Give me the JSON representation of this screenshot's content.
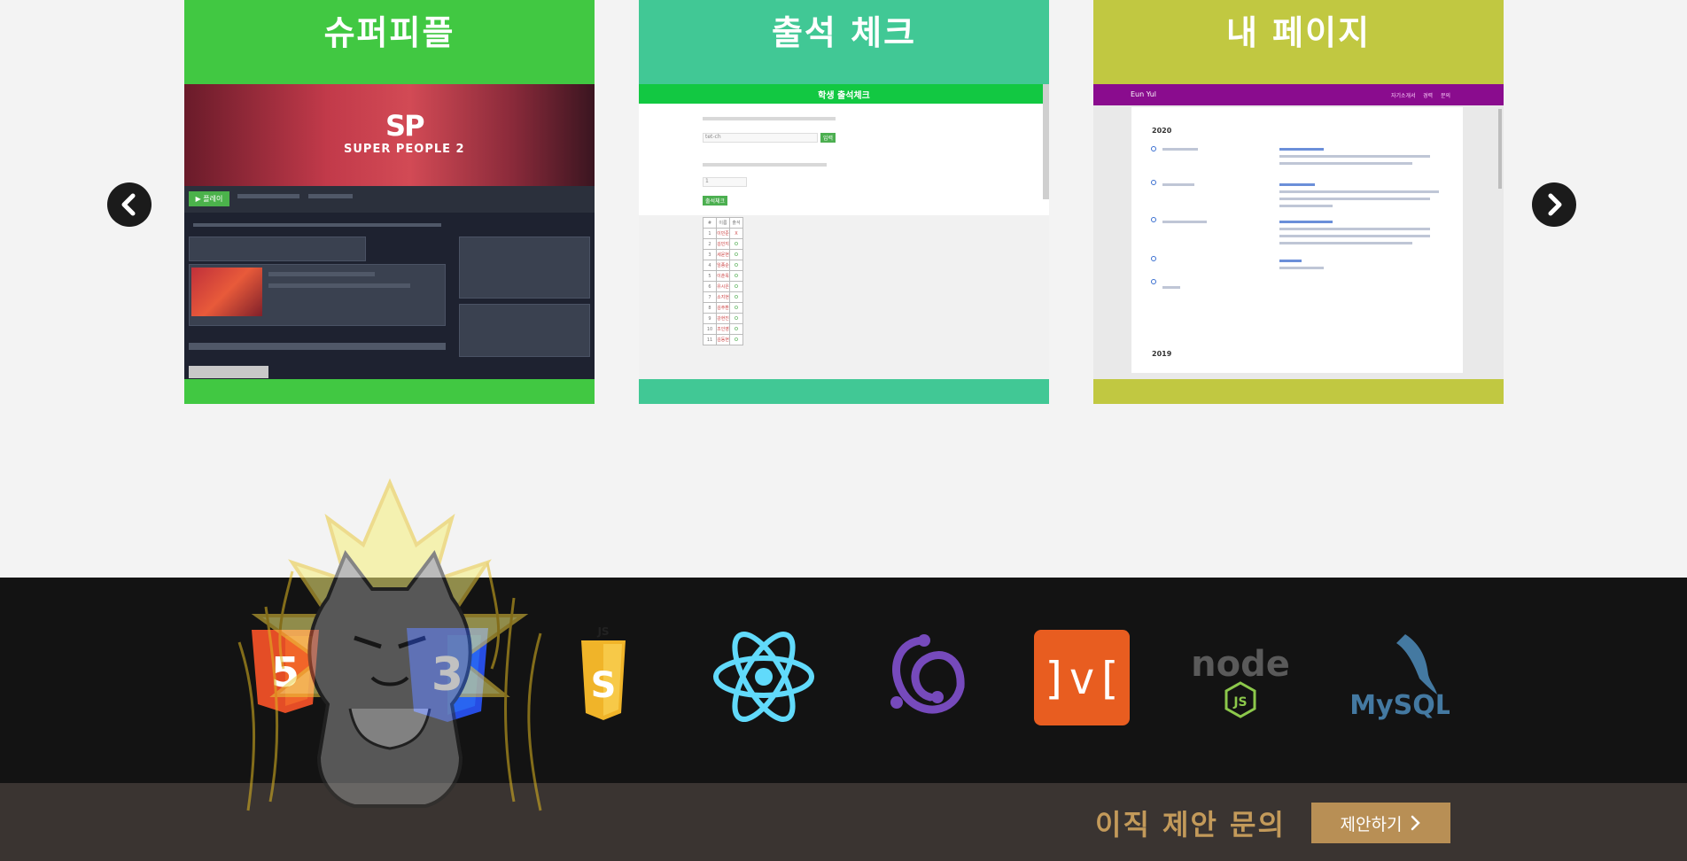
{
  "projects": [
    {
      "title": "슈퍼피플",
      "color": "#41c842",
      "shot": {
        "logo_mark": "SP",
        "logo_text": "SUPER PEOPLE 2",
        "play_label": "▶ 플레이"
      }
    },
    {
      "title": "출석 체크",
      "color": "#41c895",
      "shot": {
        "header": "학생 출석체크",
        "first_input": "tet-ch",
        "small_btn": "입력",
        "count_value": "1",
        "submit_btn": "출석체크",
        "names": [
          "이민준",
          "김민지",
          "세윤현",
          "임종순",
          "이춘옥",
          "유시은",
          "소지현",
          "김주환",
          "강현진",
          "조인영",
          "김동현"
        ],
        "statuses": [
          "X",
          "O",
          "O",
          "O",
          "O",
          "O",
          "O",
          "O",
          "O",
          "O",
          "O"
        ]
      }
    },
    {
      "title": "내 페이지",
      "color": "#c1c841",
      "shot": {
        "brand": "Eun Yul",
        "nav": [
          "자기소개서",
          "경력",
          "문의"
        ],
        "years": [
          "2020",
          "2019"
        ]
      }
    }
  ],
  "carousel": {
    "prev_icon": "chevron-left-icon",
    "next_icon": "chevron-right-icon"
  },
  "stack": [
    {
      "name": "HTML5",
      "label": "5",
      "color": "#e44d26"
    },
    {
      "name": "CSS3",
      "label": "3",
      "color": "#264de4"
    },
    {
      "name": "JavaScript",
      "label": "JS",
      "color": "#f0b429"
    },
    {
      "name": "React",
      "color": "#61dafb"
    },
    {
      "name": "Redux",
      "color": "#764abc"
    },
    {
      "name": "MobX",
      "label": "]v[",
      "color": "#e85d20"
    },
    {
      "name": "Node.js",
      "label": "node",
      "color": "#8cc84b"
    },
    {
      "name": "MySQL",
      "label": "MySQL",
      "color": "#4479a1"
    }
  ],
  "footer": {
    "headline": "이직 제안 문의",
    "button": "제안하기",
    "accent": "#c39a5a"
  }
}
